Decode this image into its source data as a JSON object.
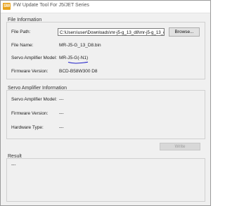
{
  "window": {
    "title": "FW Update Tool For J5/JET Series",
    "icon_text": "SW"
  },
  "file_info": {
    "group_title": "File Information",
    "file_path_label": "File Path:",
    "file_path_value": "C:\\Users\\user\\Downloads\\mr-j5-g_13_d8\\mr-j5-g_13_d",
    "browse_label": "Browse...",
    "file_name_label": "File Name:",
    "file_name_value": "MR-J5-G_13_D8.bin",
    "servo_model_label": "Servo Amplifier Model:",
    "servo_model_value": "MR-J5-G(-N1)",
    "firmware_version_label": "Firmware Version:",
    "firmware_version_value": "BCD-B58W300 D8"
  },
  "servo_info": {
    "group_title": "Servo Amplifier Information",
    "model_label": "Servo Amplifier Model:",
    "model_value": "---",
    "firmware_label": "Firmware Version:",
    "firmware_value": "---",
    "hardware_label": "Hardware Type:",
    "hardware_value": "---"
  },
  "write_label": "Write",
  "result": {
    "group_title": "Result",
    "value": "---"
  },
  "colors": {
    "annotation_underline": "#2020c8",
    "app_icon": "#e8a21a"
  }
}
